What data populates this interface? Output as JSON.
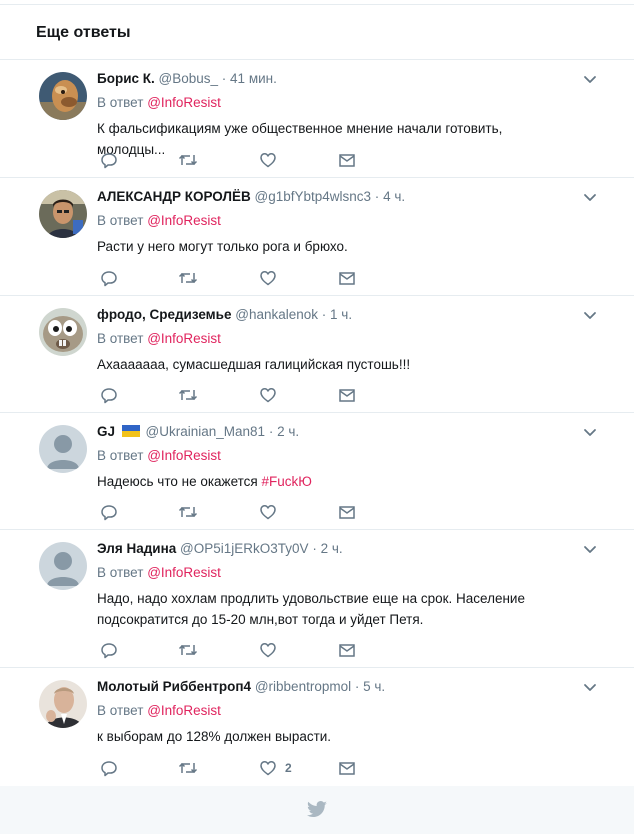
{
  "header": {
    "title": "Еще ответы"
  },
  "replies": [
    {
      "name": "Борис К.",
      "handle": "@Bobus_",
      "dot": "·",
      "time": "41 мин.",
      "reply_prefix": "В ответ",
      "reply_to": "@InfoResist",
      "text": "К фальсификациям уже общественное мнение начали готовить,  молодцы...",
      "likes": ""
    },
    {
      "name": "АЛЕКСАНДР КОРОЛЁВ",
      "handle": "@g1bfYbtp4wlsnc3",
      "dot": "·",
      "time": "4 ч.",
      "reply_prefix": "В ответ",
      "reply_to": "@InfoResist",
      "text": "Расти у него могут только рога и  брюхо.",
      "likes": ""
    },
    {
      "name": "фродо, Средиземье",
      "handle": "@hankalenok",
      "dot": "·",
      "time": "1 ч.",
      "reply_prefix": "В ответ",
      "reply_to": "@InfoResist",
      "text": "Ахааааааа, сумасшедшая галицийская пустошь!!!",
      "likes": ""
    },
    {
      "name": "GJ",
      "flag": "ukraine-flag",
      "handle": "@Ukrainian_Man81",
      "dot": "·",
      "time": "2 ч.",
      "reply_prefix": "В ответ",
      "reply_to": "@InfoResist",
      "text_plain": "Надеюсь что не окажется ",
      "text_tag": "#FuckЮ",
      "likes": ""
    },
    {
      "name": "Эля Надина",
      "handle": "@OP5i1jERkO3Ty0V",
      "dot": "·",
      "time": "2 ч.",
      "reply_prefix": "В ответ",
      "reply_to": "@InfoResist",
      "text": "Надо, надо хохлам продлить удовольствие еще на срок. Население подсократится до 15-20 млн,вот тогда и уйдет Петя.",
      "likes": ""
    },
    {
      "name": "Молотый Риббентроп4",
      "handle": "@ribbentropmol",
      "dot": "·",
      "time": "5 ч.",
      "reply_prefix": "В ответ",
      "reply_to": "@InfoResist",
      "text": "к выборам до 128% должен вырасти.",
      "likes": "2"
    }
  ],
  "colors": {
    "accent": "#e0245e",
    "muted": "#657786",
    "text": "#14171a",
    "border": "#e6ecf0",
    "footer_bg": "#f5f8fa",
    "bird": "#aab8c2"
  },
  "footer": {
    "icon": "twitter-bird-icon"
  }
}
